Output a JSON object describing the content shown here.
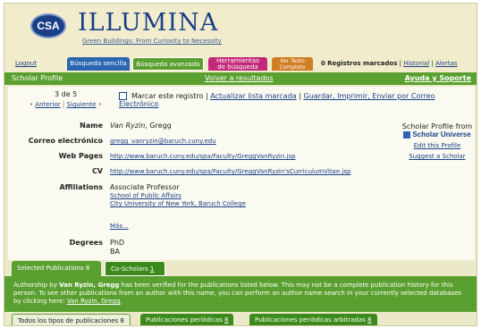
{
  "brand": {
    "logo_text": "CSA",
    "name": "ILLUMINA",
    "tagline": "Green Buildings: From Curiosity to Necessity"
  },
  "topnav": {
    "logout": "Logout",
    "tab_basic": "Búsqueda sencilla",
    "tab_advanced": "Búsqueda avanzada",
    "tab_tools_1": "Herramientas",
    "tab_tools_2": "de búsqueda",
    "tab_text_1": "Ver Texto",
    "tab_text_2": "Completo",
    "marked_count": "0",
    "marked_label": "Registros marcados",
    "history": "Historial",
    "alerts": "Alertas",
    "separator": "|"
  },
  "bar": {
    "title": "Scholar Profile",
    "back": "Volver a resultados",
    "help": "Ayuda y Soporte"
  },
  "pager": {
    "current": "3 de 5",
    "prev": "Anterior",
    "next": "Siguiente",
    "sep": "|",
    "bullet": "•"
  },
  "actions": {
    "mark": "Marcar este registro",
    "update": "Actualizar lista marcada",
    "save": "Guardar, Imprimir, Enviar por Correo Electrónico",
    "sep": "|"
  },
  "profile": {
    "name_label": "Name",
    "name_last": "Van Ryzin",
    "name_first": ", Gregg",
    "email_label": "Correo electrónico",
    "email": "gregg_vanryzin@baruch.cuny.edu",
    "web_label": "Web Pages",
    "web": "http://www.baruch.cuny.edu/spa/Faculty/GreggVanRyzin.jsp",
    "cv_label": "CV",
    "cv": "http://www.baruch.cuny.edu/spa/Faculty/GreggVanRyzin'sCurriculumVitae.jsp",
    "aff_label": "Affiliations",
    "aff_title": "Associate Professor",
    "aff_school": "School of Public Affairs",
    "aff_univ": "City University of New York, Baruch College",
    "more": "Más...",
    "degrees_label": "Degrees",
    "degree_1": "PhD",
    "degree_2": "BA"
  },
  "side": {
    "from": "Scholar Profile from",
    "su": "Scholar Universe",
    "edit": "Edit this Profile",
    "suggest": "Suggest a Scholar"
  },
  "subtabs": {
    "selected": "Selected Publications 8",
    "co_label": "Co-Scholars",
    "co_count": "1"
  },
  "notice": {
    "p1": "Authorship by ",
    "author": "Van Ryzin, Gregg",
    "p2": " has been verified for the publications listed below. This may not be a complete publication history for this person. To see other publications from an author with this name, you can perform an author name search in your currently selected databases by clicking here: ",
    "link": "Van Ryzin, Gregg",
    "end": "."
  },
  "bottabs": {
    "all": "Todos los tipos de publicaciones 8",
    "periodicas": "Publicaciones periódicas",
    "periodicas_count": "8",
    "arbitradas": "Publicaciones periódicas arbitradas",
    "arbitradas_count": "8"
  },
  "colors": {
    "green": "#5aa030",
    "blue": "#1a3f87",
    "magenta": "#c3297a",
    "orange": "#cf7e23",
    "cream": "#ece9c8"
  }
}
